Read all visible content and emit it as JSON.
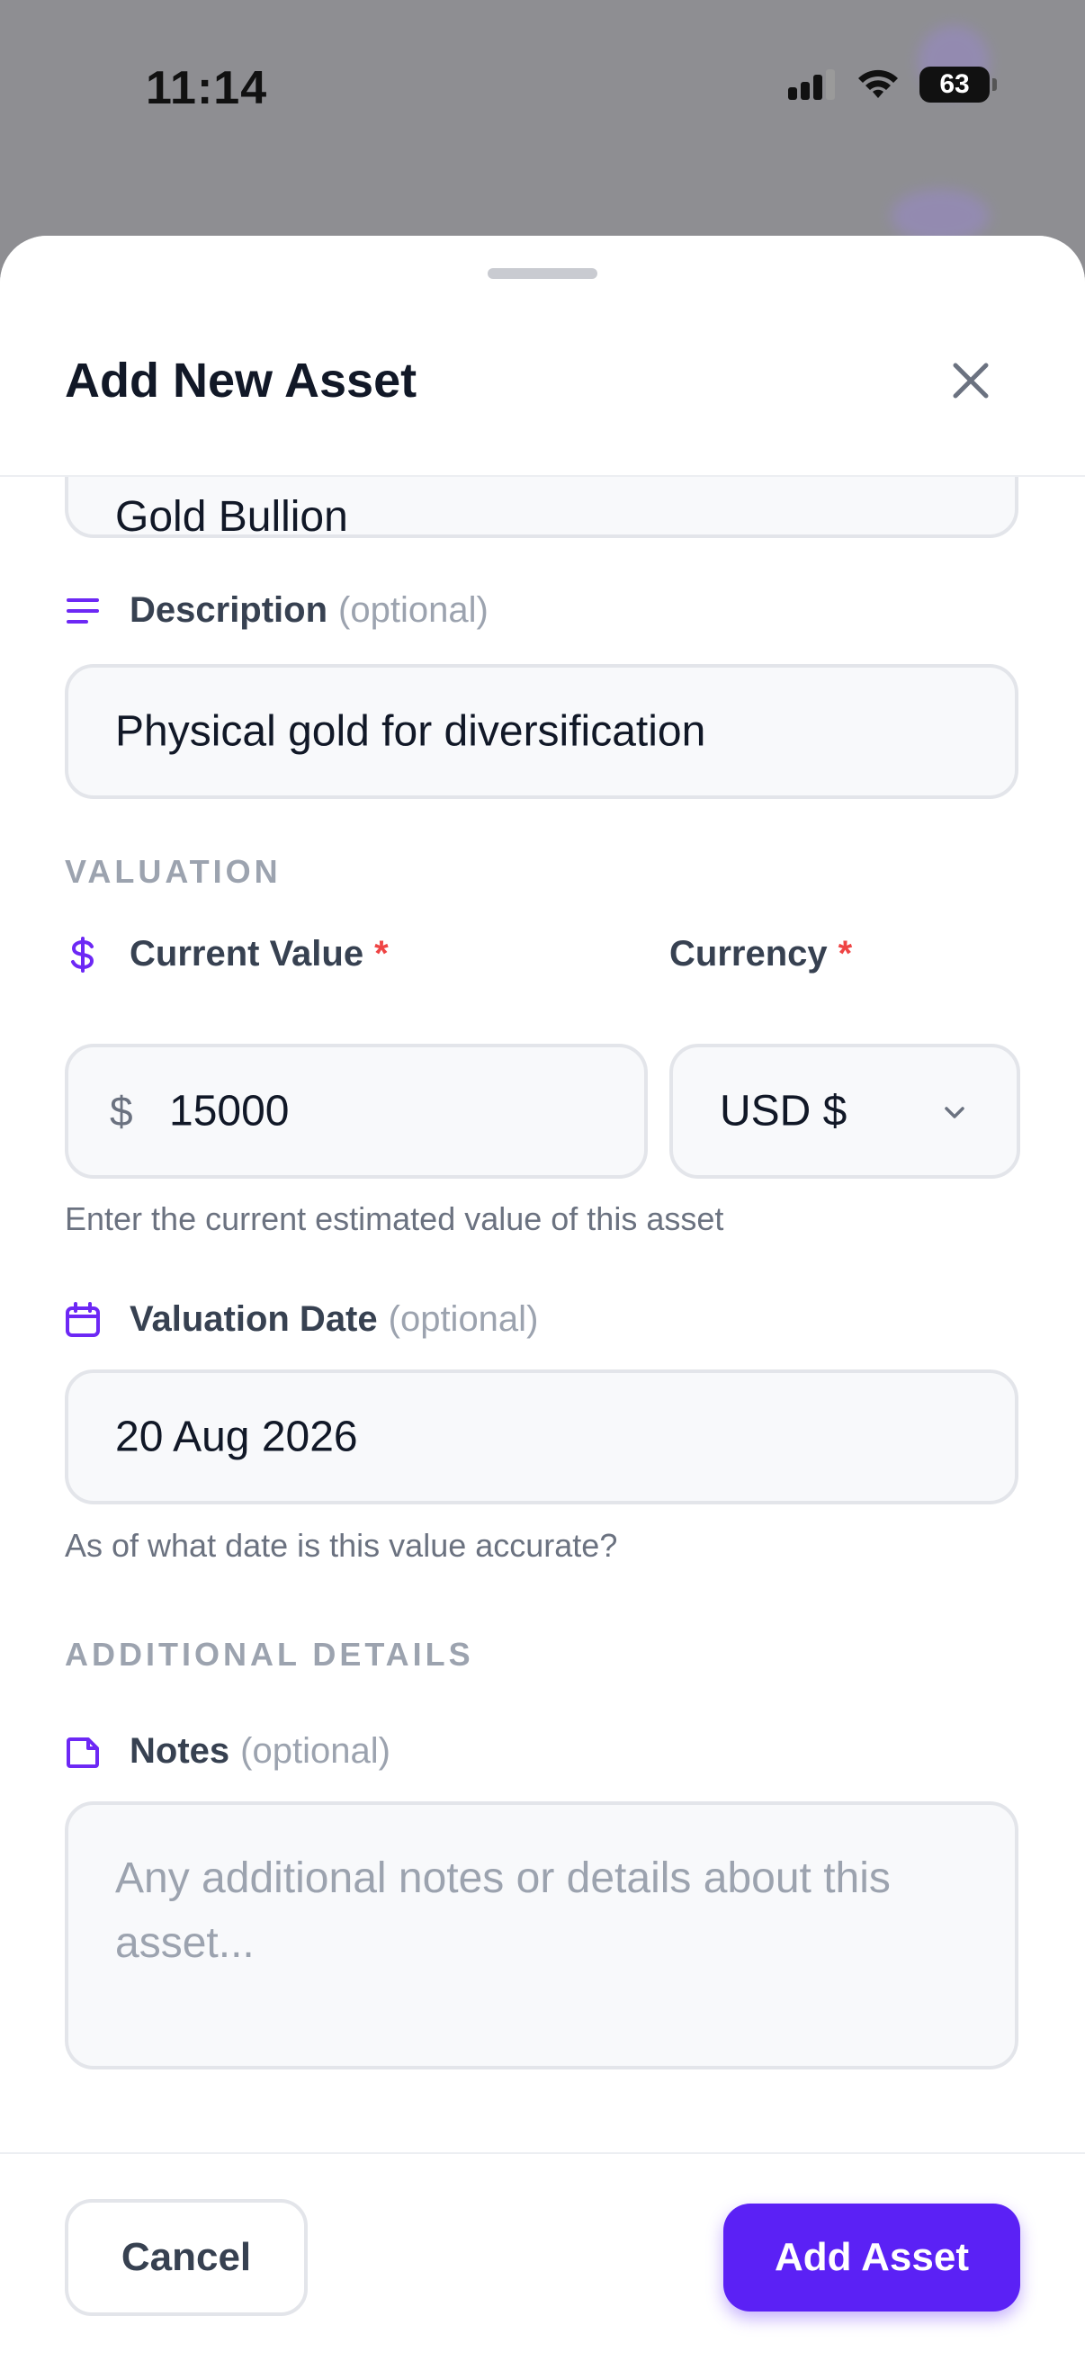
{
  "status_bar": {
    "time": "11:14",
    "battery": "63"
  },
  "sheet": {
    "title": "Add New Asset"
  },
  "fields": {
    "name_value": "Gold Bullion",
    "description": {
      "label": "Description",
      "optional": "(optional)",
      "value": "Physical gold for diversification"
    },
    "current_value": {
      "label": "Current Value",
      "required": "*",
      "prefix": "$",
      "value": "15000",
      "helper": "Enter the current estimated value of this asset"
    },
    "currency": {
      "label": "Currency",
      "required": "*",
      "value": "USD $"
    },
    "valuation_date": {
      "label": "Valuation Date",
      "optional": "(optional)",
      "value": "20 Aug 2026",
      "helper": "As of what date is this value accurate?"
    },
    "notes": {
      "label": "Notes",
      "optional": "(optional)",
      "placeholder": "Any additional notes or details about this asset..."
    }
  },
  "sections": {
    "valuation": "VALUATION",
    "additional": "ADDITIONAL DETAILS"
  },
  "footer": {
    "cancel_label": "Cancel",
    "add_label": "Add Asset"
  },
  "colors": {
    "accent": "#5b21f5",
    "required": "#ef4444",
    "muted": "#9ca3af"
  }
}
